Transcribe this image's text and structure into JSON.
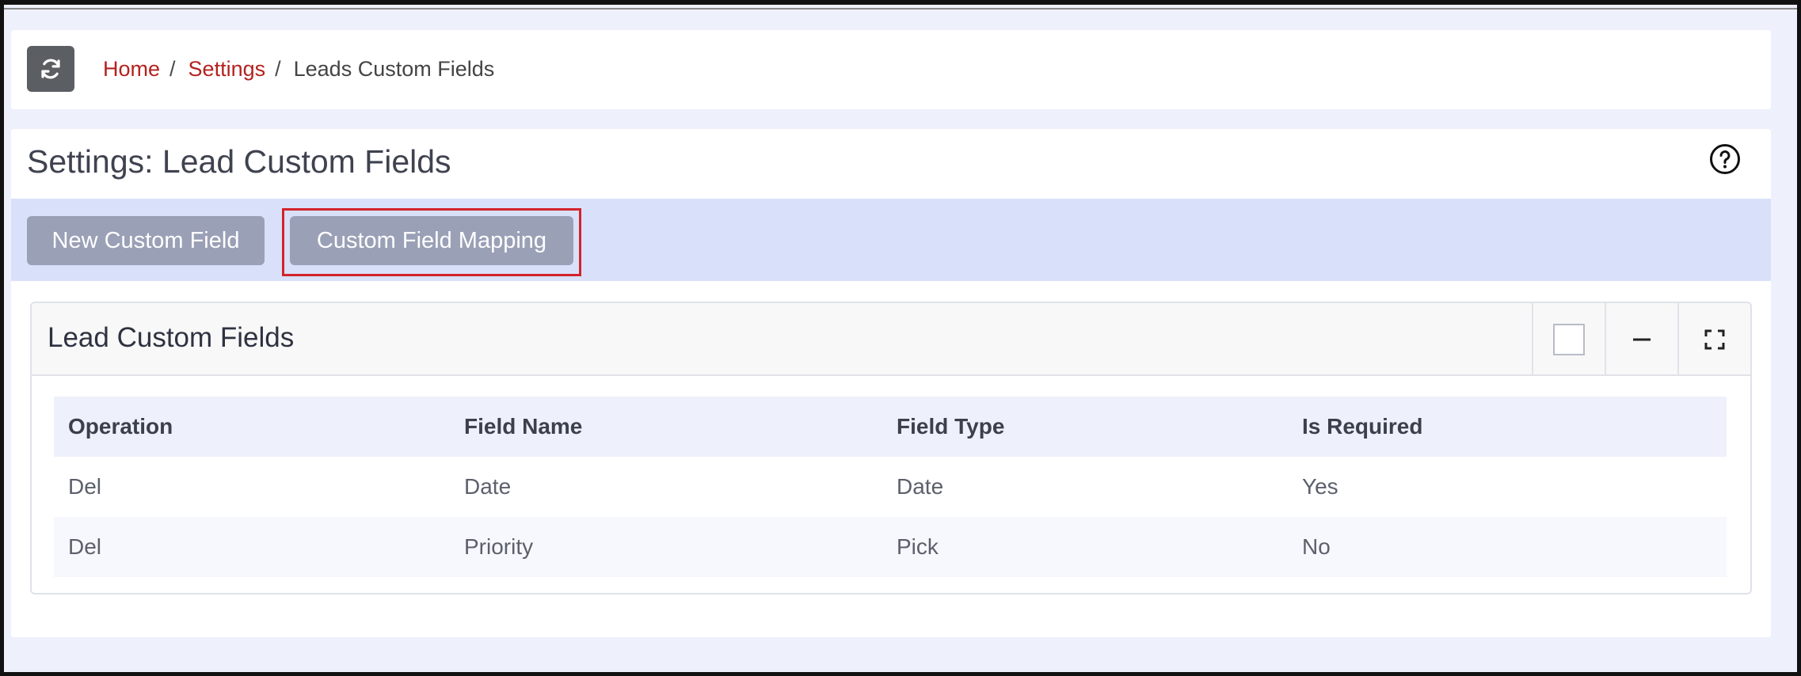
{
  "breadcrumb": {
    "home": "Home",
    "settings": "Settings",
    "current": "Leads Custom Fields",
    "separator": "/"
  },
  "icons": {
    "refresh": "refresh-icon",
    "help": "question-circle-icon",
    "minimize": "minus-icon",
    "maximize": "expand-icon"
  },
  "page": {
    "title": "Settings: Lead Custom Fields"
  },
  "toolbar": {
    "new_label": "New Custom Field",
    "mapping_label": "Custom Field Mapping"
  },
  "card": {
    "title": "Lead Custom Fields"
  },
  "table": {
    "headers": [
      "Operation",
      "Field Name",
      "Field Type",
      "Is Required"
    ],
    "rows": [
      {
        "operation": "Del",
        "field_name": "Date",
        "field_type": "Date",
        "is_required": "Yes"
      },
      {
        "operation": "Del",
        "field_name": "Priority",
        "field_type": "Pick",
        "is_required": "No"
      }
    ]
  },
  "colors": {
    "accent_link": "#b3221f",
    "toolbar_bg": "#d9e0fa",
    "button_bg": "#9aa0b6",
    "highlight": "#d2232a"
  }
}
